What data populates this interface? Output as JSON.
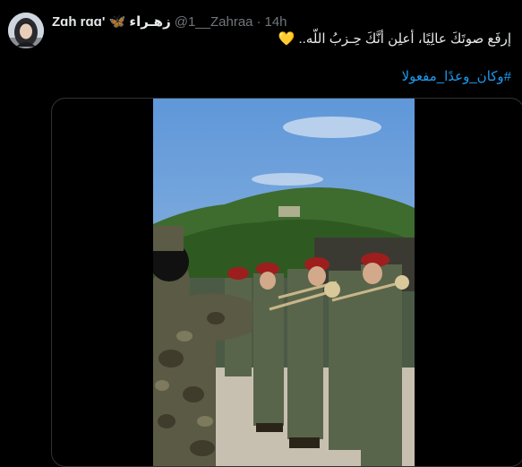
{
  "tweet": {
    "display_name": "Zɑh rɑɑ' 🦋 زهـراء",
    "handle": "@1__Zahraa",
    "separator": "·",
    "time": "14h",
    "text": "إرفَع صوتَكَ عالِيًا، أعلِن أنَّكَ حِـزبُ اللّه..",
    "heart": "💛",
    "hashtag": "#وكان_وعدًا_مفعولا"
  },
  "icons": {
    "avatar": "user-avatar",
    "butterfly": "butterfly-icon",
    "video": "video-player"
  },
  "colors": {
    "background": "#000000",
    "text": "#e7e9ea",
    "muted": "#71767b",
    "link": "#1d9bf0",
    "heart": "#f7c04a"
  }
}
